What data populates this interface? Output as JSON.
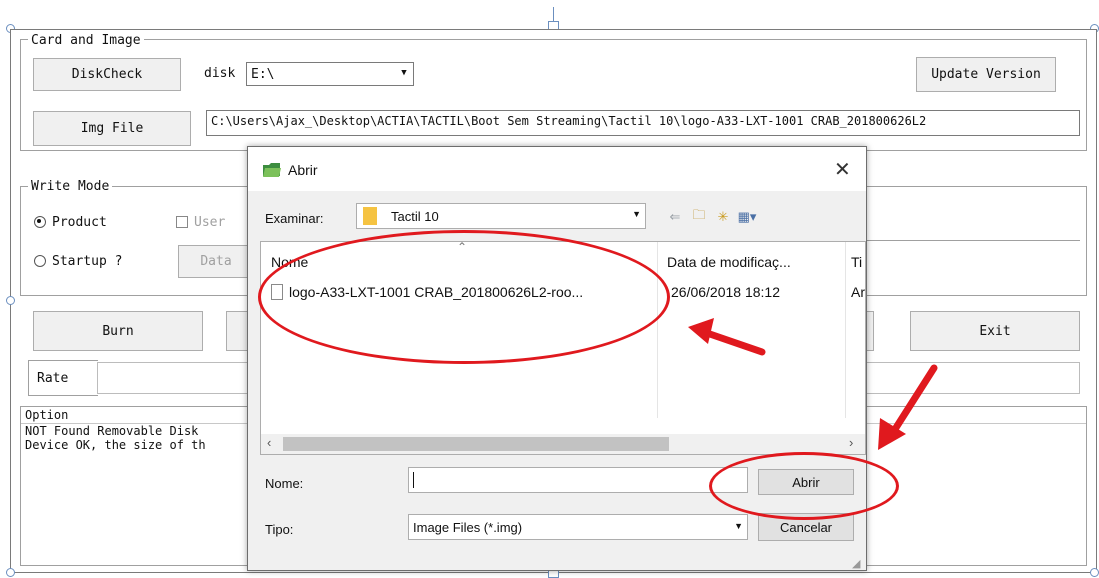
{
  "app": {
    "card_group_title": "Card and Image",
    "diskcheck_label": "DiskCheck",
    "disk_label": "disk",
    "disk_value": "E:\\",
    "update_label": "Update Version",
    "imgfile_label": "Img File",
    "img_path": "C:\\Users\\Ajax_\\Desktop\\ACTIA\\TACTIL\\Boot Sem Streaming\\Tactil 10\\logo-A33-LXT-1001 CRAB_201800626L2",
    "write_group_title": "Write Mode",
    "product_label": "Product",
    "user_label": "User",
    "startup_label": "Startup ?",
    "data_label": "Data",
    "burn_label": "Burn",
    "exit_label": "Exit",
    "rate_label": "Rate",
    "option_title": "Option",
    "log_lines": [
      "NOT Found Removable Disk",
      "Device OK, the size of th"
    ]
  },
  "dialog": {
    "title": "Abrir",
    "lookin_label": "Examinar:",
    "lookin_value": "Tactil 10",
    "col_name": "Nome",
    "col_date": "Data de modificaç...",
    "col_type": "Ti",
    "file_name": "logo-A33-LXT-1001 CRAB_201800626L2-roo...",
    "file_date": "26/06/2018 18:12",
    "file_type": "Ar",
    "name_label": "Nome:",
    "name_value": "",
    "type_label": "Tipo:",
    "type_value": "Image Files (*.img)",
    "open_label": "Abrir",
    "cancel_label": "Cancelar"
  },
  "colors": {
    "annotation": "#e0191e",
    "folder": "#f5c342"
  },
  "icons": [
    "folder-icon",
    "back-arrow-icon",
    "up-folder-icon",
    "new-folder-icon",
    "view-menu-icon",
    "file-icon",
    "close-icon",
    "dropdown-arrow-icon",
    "scroll-left-icon",
    "scroll-right-icon"
  ]
}
